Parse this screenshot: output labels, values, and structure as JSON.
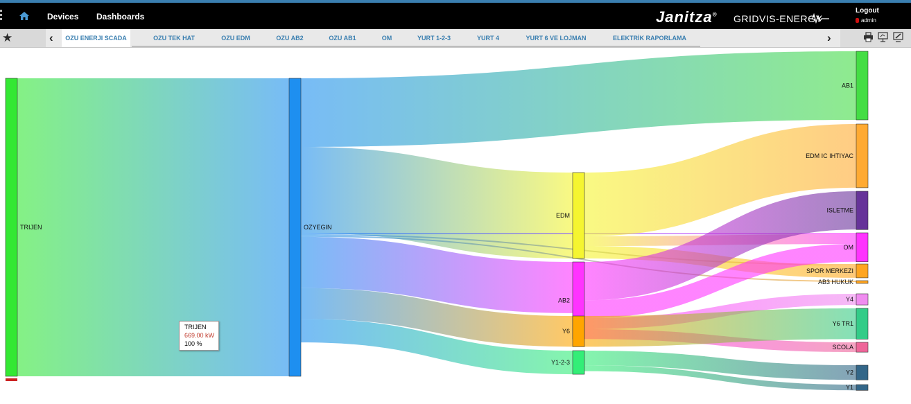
{
  "header": {
    "nav": [
      {
        "label": "Devices"
      },
      {
        "label": "Dashboards"
      }
    ],
    "brand": "Janitza",
    "brand_mark": "®",
    "product": "GRIDVIS-ENERGY",
    "logout_label": "Logout",
    "user": "admin"
  },
  "tabs": [
    {
      "label": "OZU ENERJI SCADA",
      "active": true
    },
    {
      "label": "OZU TEK HAT"
    },
    {
      "label": "OZU EDM"
    },
    {
      "label": "OZU AB2"
    },
    {
      "label": "OZU AB1"
    },
    {
      "label": "OM"
    },
    {
      "label": "YURT 1-2-3"
    },
    {
      "label": "YURT 4"
    },
    {
      "label": "YURT 6 VE LOJMAN"
    },
    {
      "label": "ELEKTRİK RAPORLAMA"
    }
  ],
  "tooltip": {
    "title": "TRIJEN",
    "value": "669.00 kW",
    "percent": "100 %"
  },
  "sankey": {
    "nodes": [
      {
        "id": "TRIJEN",
        "label": "TRIJEN",
        "color": "#33e833"
      },
      {
        "id": "OZYEGIN",
        "label": "OZYEGIN",
        "color": "#1e8ff0"
      },
      {
        "id": "EDM",
        "label": "EDM",
        "color": "#f5f530"
      },
      {
        "id": "AB2",
        "label": "AB2",
        "color": "#ff33ff"
      },
      {
        "id": "Y6",
        "label": "Y6",
        "color": "#ffa500"
      },
      {
        "id": "Y123",
        "label": "Y1-2-3",
        "color": "#33ee77"
      },
      {
        "id": "AB1",
        "label": "AB1",
        "color": "#44dd44"
      },
      {
        "id": "EDMIC",
        "label": "EDM IC IHTIYAC",
        "color": "#ffaa33"
      },
      {
        "id": "ISLETME",
        "label": "ISLETME",
        "color": "#663399"
      },
      {
        "id": "OM",
        "label": "OM",
        "color": "#ff33ff"
      },
      {
        "id": "SPOR",
        "label": "SPOR MERKEZI",
        "color": "#ffa520"
      },
      {
        "id": "AB3",
        "label": "AB3 HUKUK",
        "color": "#ffa520"
      },
      {
        "id": "Y4",
        "label": "Y4",
        "color": "#f08cf0"
      },
      {
        "id": "Y6TR1",
        "label": "Y6 TR1",
        "color": "#33cc88"
      },
      {
        "id": "SCOLA",
        "label": "SCOLA",
        "color": "#ee6699"
      },
      {
        "id": "Y2",
        "label": "Y2",
        "color": "#336688"
      },
      {
        "id": "Y1",
        "label": "Y1",
        "color": "#336688"
      }
    ],
    "links": [
      {
        "source": "TRIJEN",
        "target": "OZYEGIN",
        "value": 669
      },
      {
        "source": "OZYEGIN",
        "target": "AB1",
        "value": 154
      },
      {
        "source": "OZYEGIN",
        "target": "EDM",
        "value": 193
      },
      {
        "source": "OZYEGIN",
        "target": "OM",
        "value": 3
      },
      {
        "source": "OZYEGIN",
        "target": "SPOR",
        "value": 3
      },
      {
        "source": "OZYEGIN",
        "target": "AB3",
        "value": 3
      },
      {
        "source": "OZYEGIN",
        "target": "AB2",
        "value": 115
      },
      {
        "source": "OZYEGIN",
        "target": "Y6",
        "value": 69
      },
      {
        "source": "OZYEGIN",
        "target": "Y123",
        "value": 53
      },
      {
        "source": "EDM",
        "target": "EDMIC",
        "value": 143
      },
      {
        "source": "EDM",
        "target": "OM",
        "value": 22
      },
      {
        "source": "EDM",
        "target": "SPOR",
        "value": 28
      },
      {
        "source": "AB2",
        "target": "ISLETME",
        "value": 86
      },
      {
        "source": "AB2",
        "target": "OM",
        "value": 40
      },
      {
        "source": "AB2",
        "target": "Y4",
        "value": 25
      },
      {
        "source": "AB2",
        "target": "SCOLA",
        "value": 22
      },
      {
        "source": "Y6",
        "target": "Y6TR1",
        "value": 69
      },
      {
        "source": "Y123",
        "target": "Y2",
        "value": 33
      },
      {
        "source": "Y123",
        "target": "Y1",
        "value": 13
      }
    ]
  }
}
